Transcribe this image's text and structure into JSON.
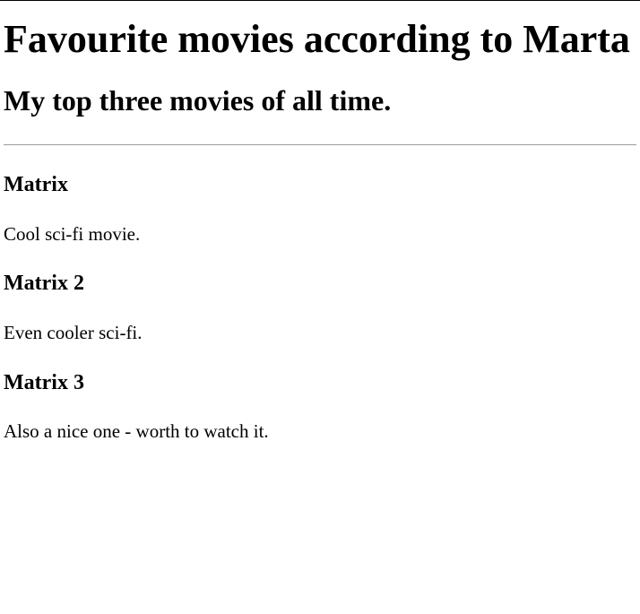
{
  "page": {
    "title": "Favourite movies according to Marta",
    "subtitle": "My top three movies of all time."
  },
  "movies": [
    {
      "title": "Matrix",
      "description": "Cool sci-fi movie."
    },
    {
      "title": "Matrix 2",
      "description": "Even cooler sci-fi."
    },
    {
      "title": "Matrix 3",
      "description": "Also a nice one - worth to watch it."
    }
  ],
  "colors": {
    "background": "#ffffff",
    "text": "#000000",
    "divider": "#9a9a9a"
  }
}
